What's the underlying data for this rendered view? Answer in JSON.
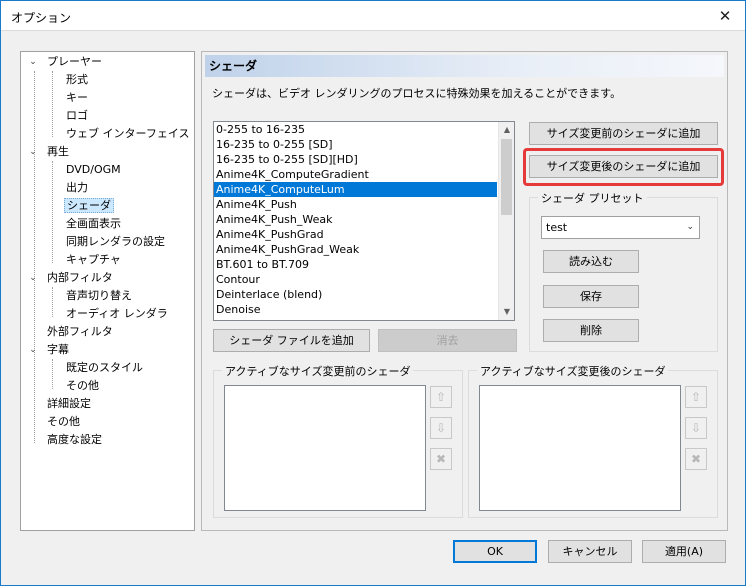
{
  "window": {
    "title": "オプション",
    "close": "✕"
  },
  "tree": {
    "items": [
      {
        "label": "プレーヤー",
        "exp": "⌄"
      },
      {
        "label": "形式"
      },
      {
        "label": "キー"
      },
      {
        "label": "ロゴ"
      },
      {
        "label": "ウェブ インターフェイス"
      },
      {
        "label": "再生",
        "exp": "⌄"
      },
      {
        "label": "DVD/OGM"
      },
      {
        "label": "出力"
      },
      {
        "label": "シェーダ"
      },
      {
        "label": "全画面表示"
      },
      {
        "label": "同期レンダラの設定"
      },
      {
        "label": "キャプチャ"
      },
      {
        "label": "内部フィルタ",
        "exp": "⌄"
      },
      {
        "label": "音声切り替え"
      },
      {
        "label": "オーディオ レンダラ"
      },
      {
        "label": "外部フィルタ"
      },
      {
        "label": "字幕",
        "exp": "⌄"
      },
      {
        "label": "既定のスタイル"
      },
      {
        "label": "その他"
      },
      {
        "label": "詳細設定"
      },
      {
        "label": "その他"
      },
      {
        "label": "高度な設定"
      }
    ]
  },
  "panel": {
    "title": "シェーダ",
    "description": "シェーダは、ビデオ レンダリングのプロセスに特殊効果を加えることができます。",
    "shaders": [
      "0-255 to 16-235",
      "16-235 to 0-255 [SD]",
      "16-235 to 0-255 [SD][HD]",
      "Anime4K_ComputeGradient",
      "Anime4K_ComputeLum",
      "Anime4K_Push",
      "Anime4K_Push_Weak",
      "Anime4K_PushGrad",
      "Anime4K_PushGrad_Weak",
      "BT.601 to BT.709",
      "Contour",
      "Deinterlace (blend)",
      "Denoise"
    ],
    "selected_shader": "Anime4K_ComputeLum",
    "add_pre_resize": "サイズ変更前のシェーダに追加",
    "add_post_resize": "サイズ変更後のシェーダに追加",
    "preset_group": "シェーダ プリセット",
    "preset_value": "test",
    "load": "読み込む",
    "save": "保存",
    "delete": "削除",
    "add_shader_file": "シェーダ ファイルを追加",
    "remove": "消去",
    "active_pre": "アクティブなサイズ変更前のシェーダ",
    "active_post": "アクティブなサイズ変更後のシェーダ",
    "up": "⇧",
    "down": "⇩",
    "clear": "✖"
  },
  "footer": {
    "ok": "OK",
    "cancel": "キャンセル",
    "apply": "適用(A)"
  },
  "colors": {
    "accent": "#0078d7",
    "highlight": "#e53a3a"
  }
}
